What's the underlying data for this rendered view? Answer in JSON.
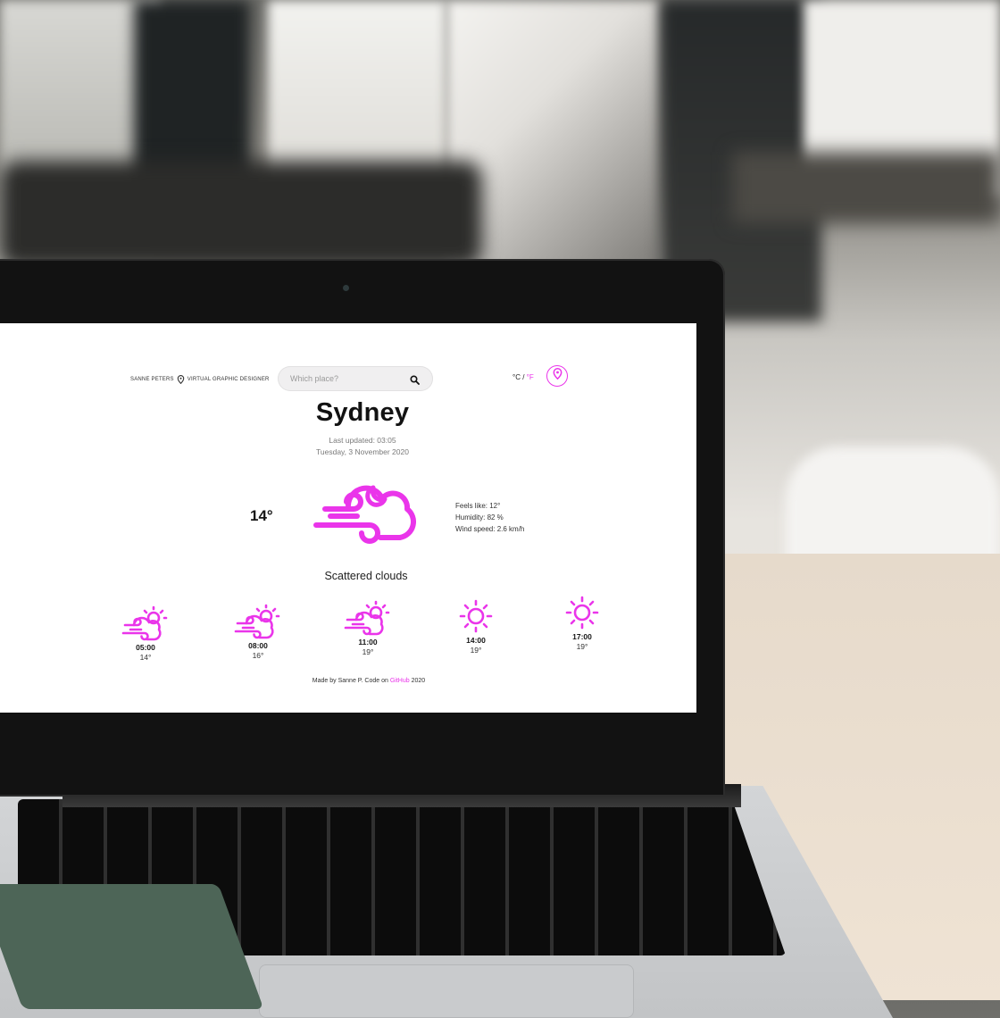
{
  "app": {
    "brand_name": "SANNE PETERS",
    "brand_role": "VIRTUAL GRAPHIC DESIGNER"
  },
  "search": {
    "placeholder": "Which place?"
  },
  "units": {
    "celsius": "°C",
    "separator": " / ",
    "fahrenheit": "°F"
  },
  "current": {
    "city": "Sydney",
    "last_updated": "Last updated: 03:05",
    "date": "Tuesday, 3 November 2020",
    "temperature": "14°",
    "feels_like": "Feels like: 12°",
    "humidity": "Humidity: 82 %",
    "wind_speed": "Wind speed: 2.6 km/h",
    "description": "Scattered clouds",
    "icon": "wind-cloud-moon-icon"
  },
  "forecast": [
    {
      "time": "05:00",
      "temp": "14°",
      "icon": "wind-cloud-sun-icon"
    },
    {
      "time": "08:00",
      "temp": "16°",
      "icon": "wind-cloud-sun-icon"
    },
    {
      "time": "11:00",
      "temp": "19°",
      "icon": "wind-cloud-sun-icon"
    },
    {
      "time": "14:00",
      "temp": "19°",
      "icon": "sun-icon"
    },
    {
      "time": "17:00",
      "temp": "19°",
      "icon": "sun-icon"
    }
  ],
  "footer": {
    "prefix": "Made by Sanne P. Code on",
    "link": "GitHub",
    "suffix": "2020"
  },
  "colors": {
    "accent": "#ea35ea",
    "text": "#121212",
    "muted": "#7a7a7a"
  }
}
